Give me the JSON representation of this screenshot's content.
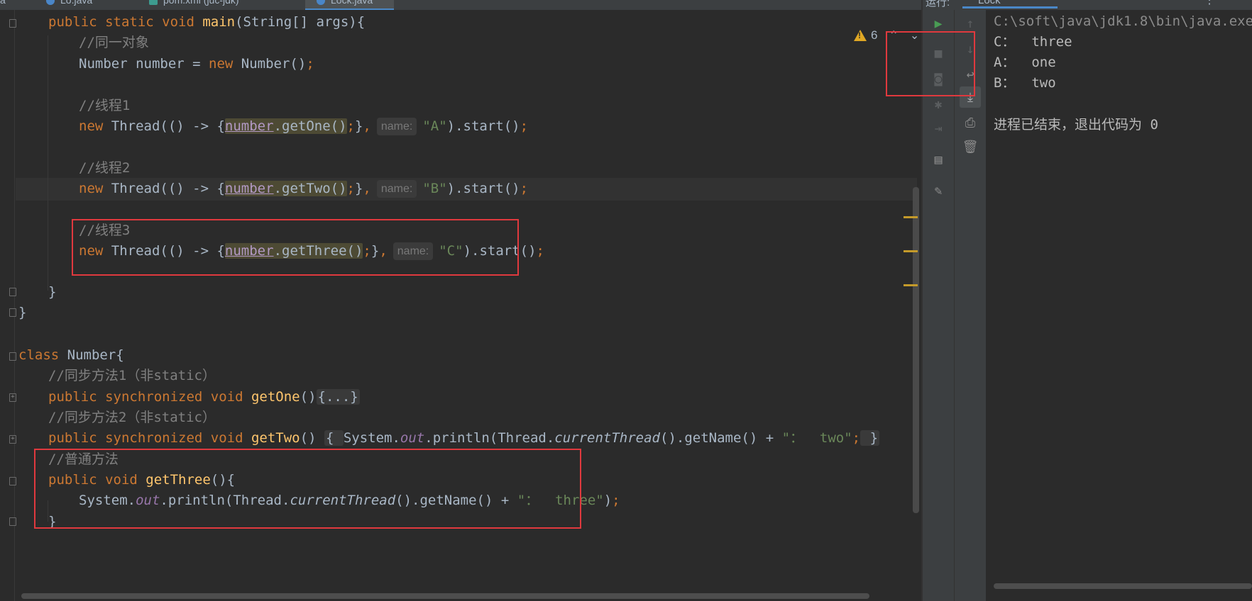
{
  "editor": {
    "tabs": [
      "a",
      "Lo.java",
      "pom.xml (juc-jdk)",
      "Lock.java"
    ],
    "warning_count": "6",
    "lines": {
      "main_sig": "public static void main(String[] args){",
      "c_same_object": "//同一对象",
      "number_decl": "Number number = new Number();",
      "c_thread1": "//线程1",
      "c_thread2": "//线程2",
      "c_thread3": "//线程3",
      "param_hint": "name:",
      "arg_a": "\"A\"",
      "arg_b": "\"B\"",
      "arg_c": "\"C\"",
      "class_decl": "class Number{",
      "c_sync1": "//同步方法1（非static）",
      "c_sync2": "//同步方法2（非static）",
      "c_normal": "//普通方法",
      "get_one": "getOne",
      "get_two": "getTwo",
      "get_three": "getThree",
      "folded_body": "{...}",
      "two_str": "\"：  two\"",
      "three_str": "\"：  three\""
    }
  },
  "run": {
    "title": "运行:",
    "tab_label": "Lock",
    "command": "C:\\soft\\java\\jdk1.8\\bin\\java.exe",
    "output": [
      "C：  three",
      "A：  one",
      "B：  two"
    ],
    "exit_message": "进程已结束，退出代码为 0"
  },
  "icons": {
    "run": "play-icon",
    "stop": "stop-icon",
    "up": "arrow-up-icon",
    "down": "arrow-down-icon",
    "soft_wrap": "soft-wrap-icon",
    "scroll_end": "scroll-to-end-icon",
    "print": "print-icon",
    "clear": "trash-icon"
  },
  "colors": {
    "highlight_box": "#e0393e",
    "keyword": "#cc7832",
    "method": "#ffc66d",
    "string": "#6a8759",
    "comment": "#808080"
  }
}
